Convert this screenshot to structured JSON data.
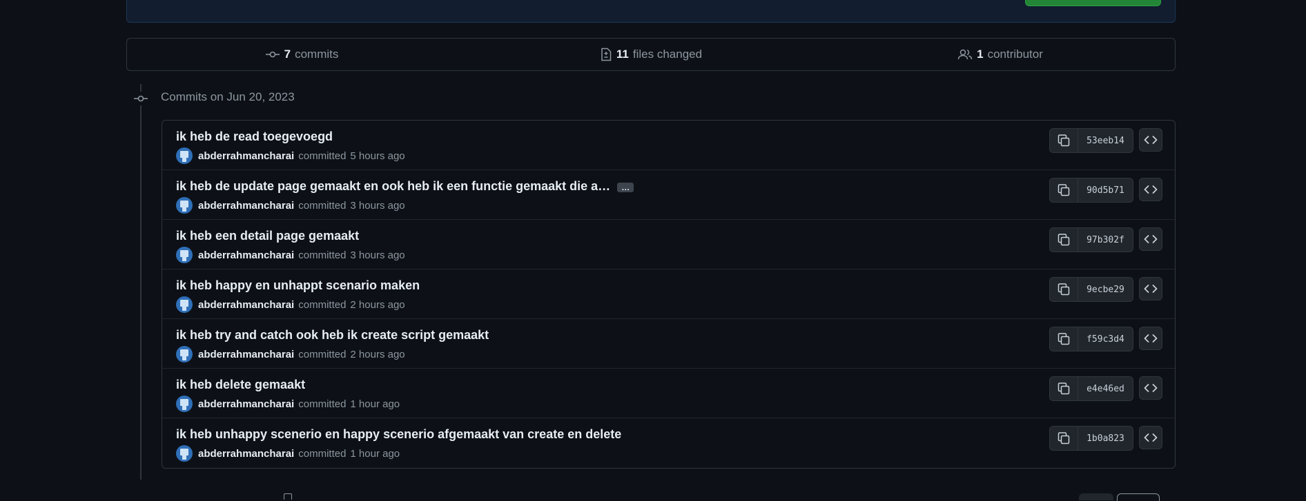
{
  "summary": {
    "commits_count": "7",
    "commits_label": "commits",
    "files_count": "11",
    "files_label": "files changed",
    "contributors_count": "1",
    "contributors_label": "contributor"
  },
  "group": {
    "title": "Commits on Jun 20, 2023"
  },
  "commits": [
    {
      "message": "ik heb de read toegevoegd",
      "author": "abderrahmancharai",
      "verb": "committed",
      "time": "5 hours ago",
      "sha": "53eeb14",
      "truncated": false
    },
    {
      "message": "ik heb de update page gemaakt en ook heb ik een functie gemaakt die a…",
      "author": "abderrahmancharai",
      "verb": "committed",
      "time": "3 hours ago",
      "sha": "90d5b71",
      "truncated": true,
      "ellipsis": "…"
    },
    {
      "message": "ik heb een detail page gemaakt",
      "author": "abderrahmancharai",
      "verb": "committed",
      "time": "3 hours ago",
      "sha": "97b302f",
      "truncated": false
    },
    {
      "message": "ik heb happy en unhappt scenario maken",
      "author": "abderrahmancharai",
      "verb": "committed",
      "time": "2 hours ago",
      "sha": "9ecbe29",
      "truncated": false
    },
    {
      "message": "ik heb try and catch ook heb ik create script gemaakt",
      "author": "abderrahmancharai",
      "verb": "committed",
      "time": "2 hours ago",
      "sha": "f59c3d4",
      "truncated": false
    },
    {
      "message": "ik heb delete gemaakt",
      "author": "abderrahmancharai",
      "verb": "committed",
      "time": "1 hour ago",
      "sha": "e4e46ed",
      "truncated": false
    },
    {
      "message": "ik heb unhappy scenerio en happy scenerio afgemaakt van create en delete",
      "author": "abderrahmancharai",
      "verb": "committed",
      "time": "1 hour ago",
      "sha": "1b0a823",
      "truncated": false
    }
  ],
  "icons": {
    "commit": "git-commit-icon",
    "files": "file-diff-icon",
    "contributors": "people-icon",
    "copy": "copy-icon",
    "browse": "code-icon"
  },
  "colors": {
    "background": "#0d1117",
    "border": "#30363d",
    "muted_text": "#8d96a0",
    "text": "#e6edf3",
    "accent_green": "#238636"
  }
}
